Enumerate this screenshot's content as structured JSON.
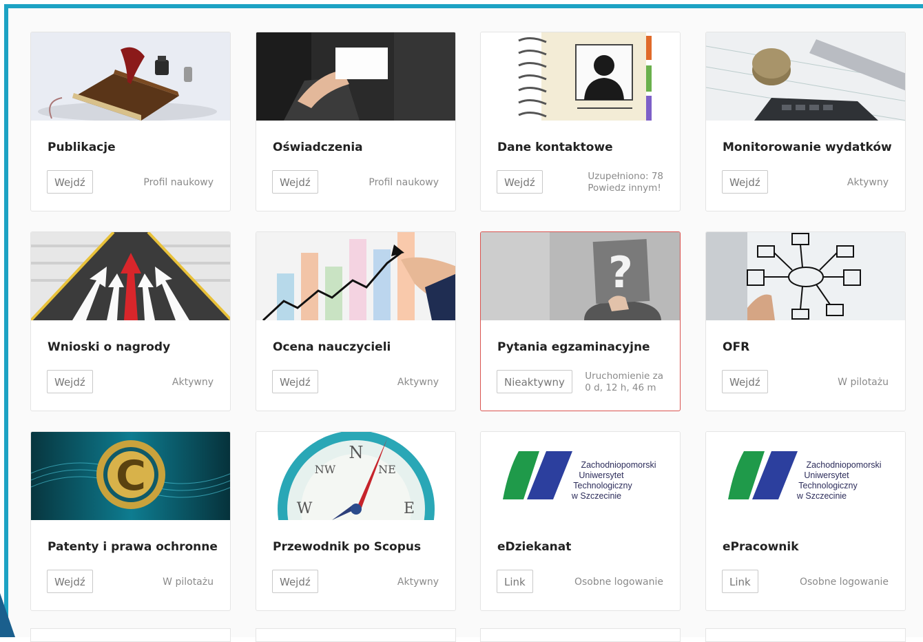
{
  "cards": [
    {
      "title": "Publikacje",
      "button": "Wejdź",
      "status": "Profil naukowy"
    },
    {
      "title": "Oświadczenia",
      "button": "Wejdź",
      "status": "Profil naukowy"
    },
    {
      "title": "Dane kontaktowe",
      "button": "Wejdź",
      "status_line1": "Uzupełniono: 78",
      "status_line2": "Powiedz innym!"
    },
    {
      "title": "Monitorowanie wydatków",
      "button": "Wejdź",
      "status": "Aktywny"
    },
    {
      "title": "Wnioski o nagrody",
      "button": "Wejdź",
      "status": "Aktywny"
    },
    {
      "title": "Ocena nauczycieli",
      "button": "Wejdź",
      "status": "Aktywny"
    },
    {
      "title": "Pytania egzaminacyjne",
      "button": "Nieaktywny",
      "status_line1": "Uruchomienie za",
      "status_line2": "0 d, 12 h, 46 m"
    },
    {
      "title": "OFR",
      "button": "Wejdź",
      "status": "W pilotażu"
    },
    {
      "title": "Patenty i prawa ochronne",
      "button": "Wejdź",
      "status": "W pilotażu"
    },
    {
      "title": "Przewodnik po Scopus",
      "button": "Wejdź",
      "status": "Aktywny"
    },
    {
      "title": "eDziekanat",
      "button": "Link",
      "status": "Osobne logowanie"
    },
    {
      "title": "ePracownik",
      "button": "Link",
      "status": "Osobne logowanie"
    }
  ],
  "logo": {
    "line1": "Zachodniopomorski",
    "line2": "Uniwersytet",
    "line3": "Technologiczny",
    "line4": "w Szczecinie"
  },
  "compass": {
    "n": "N",
    "ne": "NE",
    "nw": "NW",
    "w": "W",
    "e": "E"
  },
  "colors": {
    "accent": "#1ea3c4",
    "highlight": "#d9534f",
    "logo_green": "#1f9a4a",
    "logo_blue": "#2c3f9e"
  }
}
